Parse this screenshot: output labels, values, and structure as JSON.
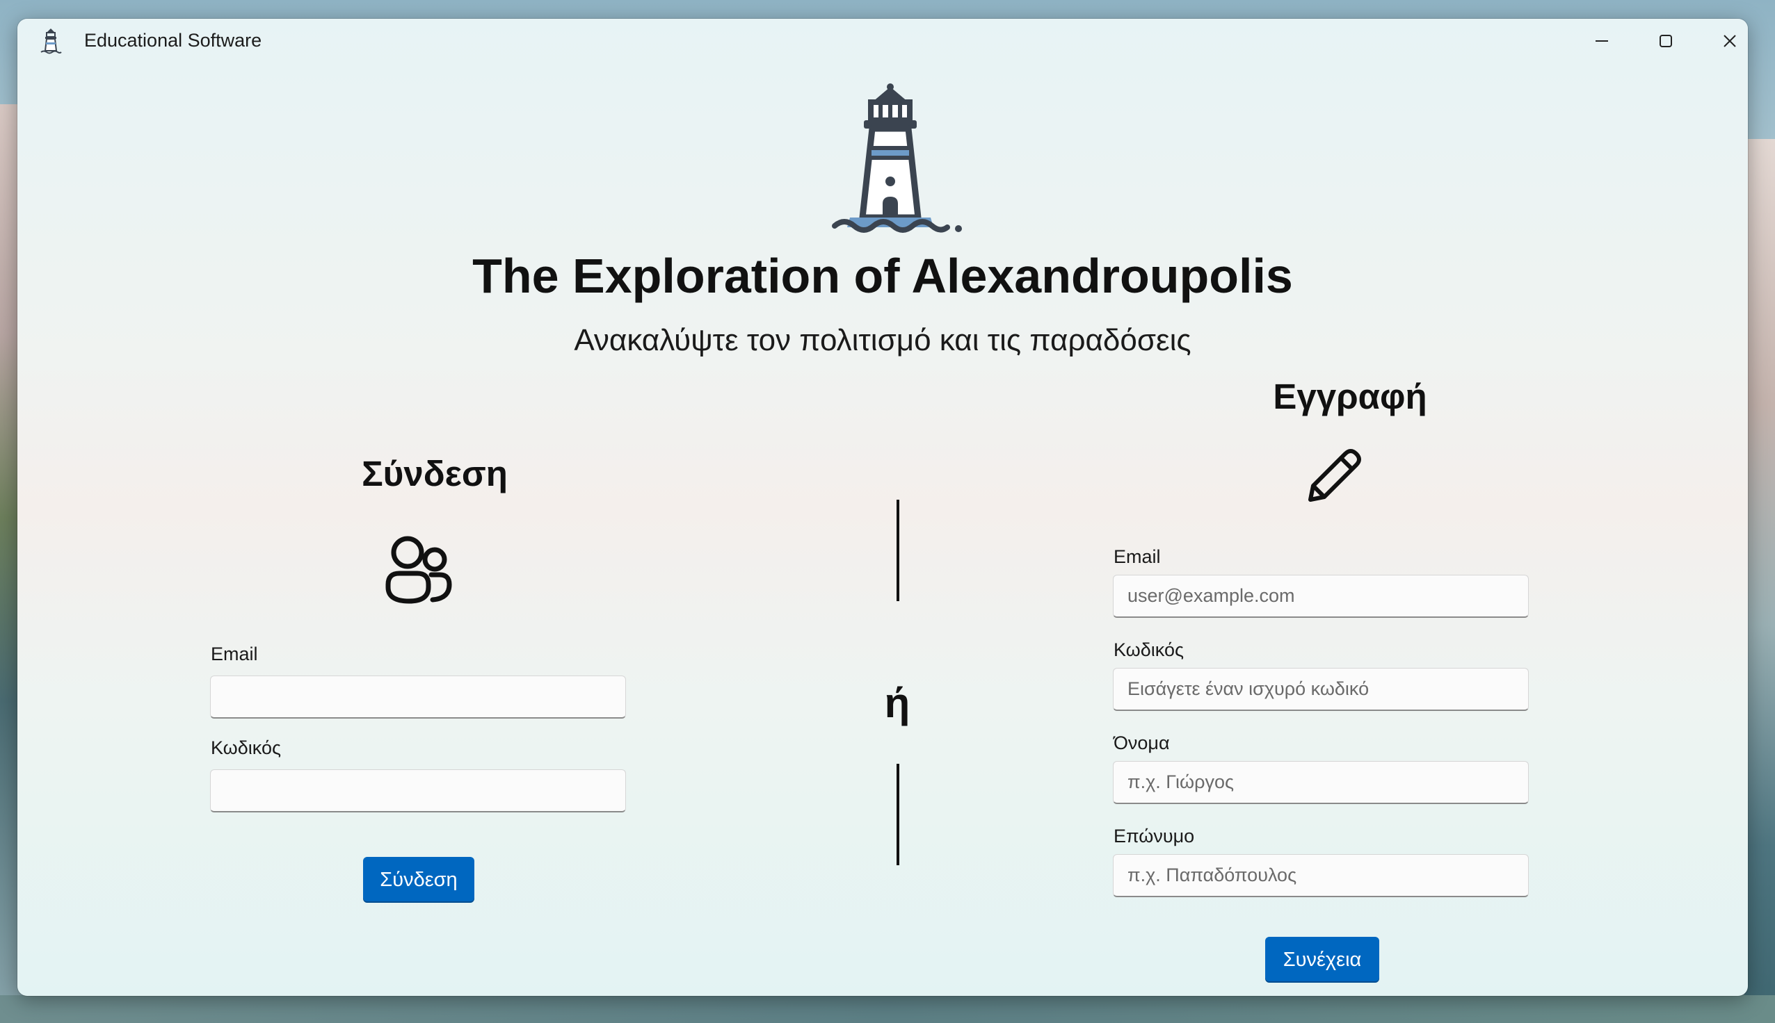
{
  "window": {
    "title": "Educational Software",
    "icon": "lighthouse-icon",
    "controls": [
      "minimize-icon",
      "maximize-icon",
      "close-icon"
    ]
  },
  "hero": {
    "icon": "lighthouse-icon",
    "title": "The Exploration of Alexandroupolis",
    "subtitle": "Ανακαλύψτε τον πολιτισμό και τις παραδόσεις"
  },
  "login": {
    "heading": "Σύνδεση",
    "icon": "people-icon",
    "email_label": "Email",
    "email_value": "",
    "password_label": "Κωδικός",
    "password_value": "",
    "submit_label": "Σύνδεση"
  },
  "separator": {
    "text": "ή"
  },
  "register": {
    "heading": "Εγγραφή",
    "icon": "pencil-icon",
    "email_label": "Email",
    "email_placeholder": "user@example.com",
    "password_label": "Κωδικός",
    "password_placeholder": "Εισάγετε έναν ισχυρό κωδικό",
    "first_name_label": "Όνομα",
    "first_name_placeholder": "π.χ. Γιώργος",
    "last_name_label": "Επώνυμο",
    "last_name_placeholder": "π.χ. Παπαδόπουλος",
    "submit_label": "Συνέχεια"
  },
  "colors": {
    "accent": "#0067c0",
    "lighthouse_dark": "#3b4450",
    "lighthouse_blue": "#6d9bc8"
  }
}
